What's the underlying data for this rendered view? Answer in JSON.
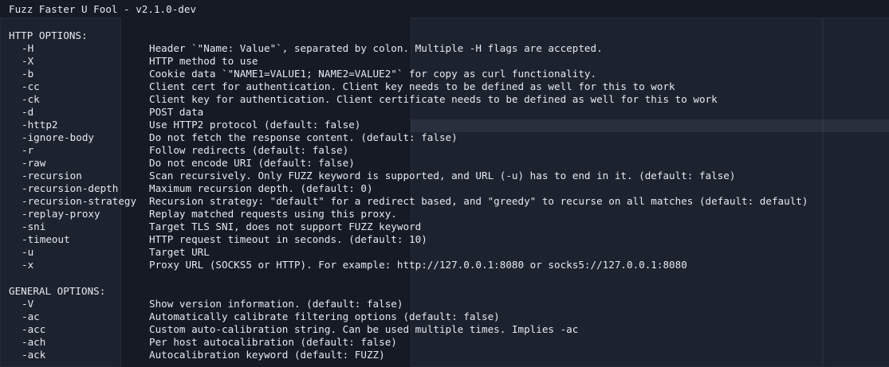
{
  "title": "Fuzz Faster U Fool - v2.1.0-dev",
  "http_options": {
    "heading": "HTTP OPTIONS:",
    "items": [
      {
        "flag": "-H",
        "desc": "Header `\"Name: Value\"`, separated by colon. Multiple -H flags are accepted."
      },
      {
        "flag": "-X",
        "desc": "HTTP method to use"
      },
      {
        "flag": "-b",
        "desc": "Cookie data `\"NAME1=VALUE1; NAME2=VALUE2\"` for copy as curl functionality."
      },
      {
        "flag": "-cc",
        "desc": "Client cert for authentication. Client key needs to be defined as well for this to work"
      },
      {
        "flag": "-ck",
        "desc": "Client key for authentication. Client certificate needs to be defined as well for this to work"
      },
      {
        "flag": "-d",
        "desc": "POST data"
      },
      {
        "flag": "-http2",
        "desc": "Use HTTP2 protocol (default: false)"
      },
      {
        "flag": "-ignore-body",
        "desc": "Do not fetch the response content. (default: false)"
      },
      {
        "flag": "-r",
        "desc": "Follow redirects (default: false)"
      },
      {
        "flag": "-raw",
        "desc": "Do not encode URI (default: false)"
      },
      {
        "flag": "-recursion",
        "desc": "Scan recursively. Only FUZZ keyword is supported, and URL (-u) has to end in it. (default: false)"
      },
      {
        "flag": "-recursion-depth",
        "desc": "Maximum recursion depth. (default: 0)"
      },
      {
        "flag": "-recursion-strategy",
        "desc": "Recursion strategy: \"default\" for a redirect based, and \"greedy\" to recurse on all matches (default: default)"
      },
      {
        "flag": "-replay-proxy",
        "desc": "Replay matched requests using this proxy."
      },
      {
        "flag": "-sni",
        "desc": "Target TLS SNI, does not support FUZZ keyword"
      },
      {
        "flag": "-timeout",
        "desc": "HTTP request timeout in seconds. (default: 10)"
      },
      {
        "flag": "-u",
        "desc": "Target URL"
      },
      {
        "flag": "-x",
        "desc": "Proxy URL (SOCKS5 or HTTP). For example: http://127.0.0.1:8080 or socks5://127.0.0.1:8080"
      }
    ]
  },
  "general_options": {
    "heading": "GENERAL OPTIONS:",
    "items": [
      {
        "flag": "-V",
        "desc": "Show version information. (default: false)"
      },
      {
        "flag": "-ac",
        "desc": "Automatically calibrate filtering options (default: false)"
      },
      {
        "flag": "-acc",
        "desc": "Custom auto-calibration string. Can be used multiple times. Implies -ac"
      },
      {
        "flag": "-ach",
        "desc": "Per host autocalibration (default: false)"
      },
      {
        "flag": "-ack",
        "desc": "Autocalibration keyword (default: FUZZ)"
      }
    ]
  },
  "colors": {
    "background": "#151a24",
    "text": "#e6e9ef"
  }
}
